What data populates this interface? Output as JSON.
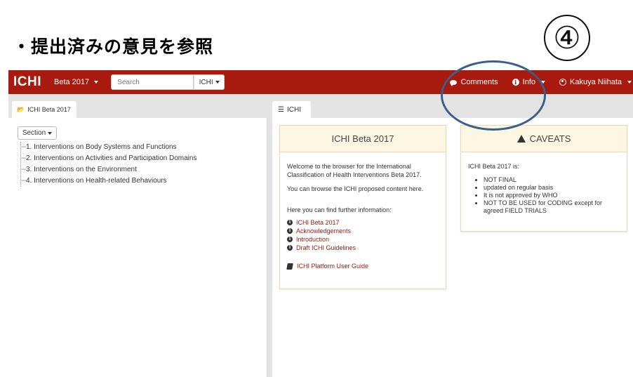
{
  "slide": {
    "heading": "・提出済みの意見を参照",
    "step_number": "④"
  },
  "navbar": {
    "brand": "ICHI",
    "version": "Beta 2017",
    "search_placeholder": "Search",
    "search_scope": "ICHI",
    "comments": "Comments",
    "info": "Info",
    "user": "Kakuya Niihata"
  },
  "left": {
    "tab_label": "ICHI Beta 2017",
    "section_button": "Section",
    "tree": [
      "1. Interventions on Body Systems and Functions",
      "2. Interventions on Activities and Participation Domains",
      "3. Interventions on the Environment",
      "4. Interventions on Health-related Behaviours"
    ]
  },
  "right": {
    "tab_label": "ICHI",
    "info_card": {
      "title": "ICHI Beta 2017",
      "welcome": "Welcome to the browser for the International Classification of Health Interventions Beta 2017.",
      "browse": "You can browse the ICHI proposed content here.",
      "further": "Here you can find further information:",
      "links": [
        "ICHI Beta 2017",
        "Acknowledgements",
        "Introduction",
        "Draft ICHI Guidelines"
      ],
      "guide": "ICHI Platform User Guide"
    },
    "caveats_card": {
      "title": "CAVEATS",
      "intro": "ICHI Beta 2017 is:",
      "items": [
        "NOT FINAL",
        "updated on regular basis",
        "It is not approved by WHO",
        "NOT TO BE USED for CODING except for agreed FIELD TRIALS"
      ]
    }
  }
}
